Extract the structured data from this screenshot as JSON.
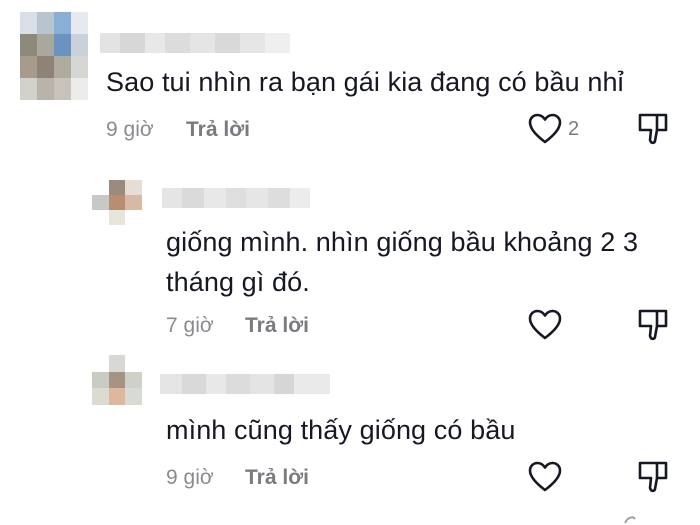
{
  "comments": [
    {
      "text": "Sao tui nhìn ra bạn gái kia đang có bầu nhỉ",
      "time": "9 giờ",
      "reply_label": "Trả lời",
      "like_count": "2"
    },
    {
      "text_line1": "giống mình. nhìn giống bầu khoảng 2 3",
      "text_line2": "tháng gì đó.",
      "time": "7 giờ",
      "reply_label": "Trả lời"
    },
    {
      "text": "mình cũng thấy giống có bầu",
      "time": "9 giờ",
      "reply_label": "Trả lời"
    }
  ],
  "icons": {
    "like": "heart-outline-icon",
    "dislike": "thumbs-down-outline-icon"
  },
  "colors": {
    "text": "#161823",
    "meta": "#8a8b91",
    "icon": "#161823"
  }
}
